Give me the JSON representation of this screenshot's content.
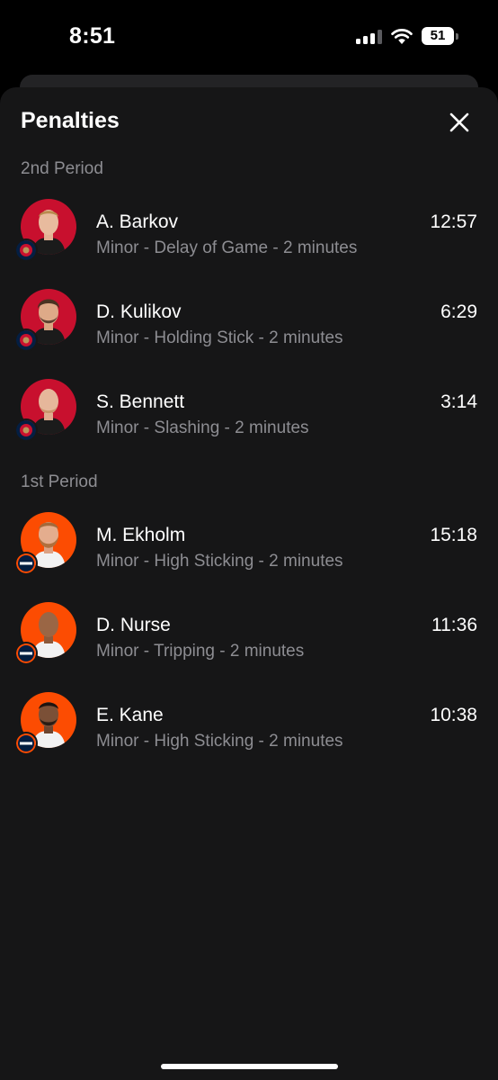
{
  "status_bar": {
    "time": "8:51",
    "battery": "51"
  },
  "sheet": {
    "title": "Penalties"
  },
  "colors": {
    "panthers_red": "#c8102e",
    "oilers_orange": "#fc4c02",
    "oilers_blue": "#041e42"
  },
  "periods": [
    {
      "label": "2nd Period",
      "penalties": [
        {
          "player": "A. Barkov",
          "description": "Minor - Delay of Game - 2 minutes",
          "time": "12:57",
          "team": "panthers"
        },
        {
          "player": "D. Kulikov",
          "description": "Minor - Holding Stick - 2 minutes",
          "time": "6:29",
          "team": "panthers"
        },
        {
          "player": "S. Bennett",
          "description": "Minor - Slashing - 2 minutes",
          "time": "3:14",
          "team": "panthers"
        }
      ]
    },
    {
      "label": "1st Period",
      "penalties": [
        {
          "player": "M. Ekholm",
          "description": "Minor - High Sticking - 2 minutes",
          "time": "15:18",
          "team": "oilers"
        },
        {
          "player": "D. Nurse",
          "description": "Minor - Tripping - 2 minutes",
          "time": "11:36",
          "team": "oilers"
        },
        {
          "player": "E. Kane",
          "description": "Minor - High Sticking - 2 minutes",
          "time": "10:38",
          "team": "oilers"
        }
      ]
    }
  ]
}
